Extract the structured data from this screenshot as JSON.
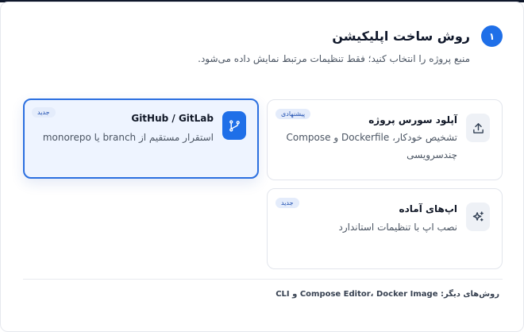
{
  "header": {
    "step": "۱",
    "title": "روش ساخت اپلیکیشن",
    "subtitle": "منبع پروژه را انتخاب کنید؛ فقط تنظیمات مرتبط نمایش داده می‌شود."
  },
  "options": [
    {
      "title": "آپلود سورس پروژه",
      "badge": "پیشنهادی",
      "description": "تشخیص خودکار، Dockerfile و Compose چندسرویسی",
      "icon": "upload-icon",
      "selected": false
    },
    {
      "title": "GitHub / GitLab",
      "badge": "جدید",
      "description": "استقرار مستقیم از branch یا monorepo",
      "icon": "git-branch-icon",
      "selected": true
    },
    {
      "title": "اپ‌های آماده",
      "badge": "جدید",
      "description": "نصب اپ با تنظیمات استاندارد",
      "icon": "sparkle-icon",
      "selected": false
    }
  ],
  "footer": {
    "text": "روش‌های دیگر: Compose Editor، Docker Image و CLI"
  },
  "colors": {
    "accent": "#1f6fe8",
    "selected_border": "#2b6fe0",
    "selected_bg": "#eef4ff",
    "badge_bg": "#e4ecfb"
  }
}
